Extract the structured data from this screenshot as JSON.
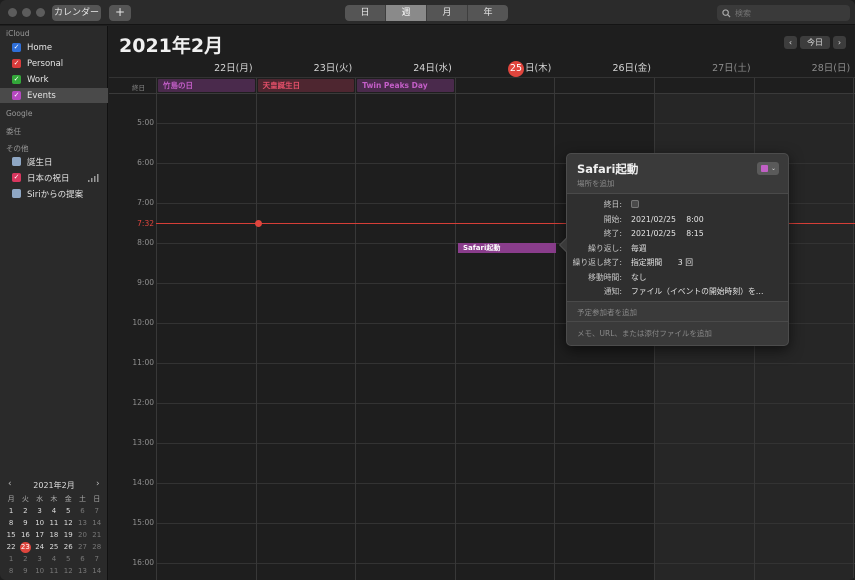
{
  "toolbar": {
    "calendars_label": "カレンダー",
    "add_label": "+",
    "views": [
      {
        "label": "日",
        "active": false
      },
      {
        "label": "週",
        "active": true
      },
      {
        "label": "月",
        "active": false
      },
      {
        "label": "年",
        "active": false
      }
    ],
    "search_placeholder": "検索"
  },
  "sidebar": {
    "icloud_header": "iCloud",
    "icloud": [
      {
        "label": "Home",
        "color": "#2f6fd8",
        "checked": true,
        "selected": false
      },
      {
        "label": "Personal",
        "color": "#d83b3b",
        "checked": true,
        "selected": false
      },
      {
        "label": "Work",
        "color": "#33a83a",
        "checked": true,
        "selected": false
      },
      {
        "label": "Events",
        "color": "#b548c0",
        "checked": true,
        "selected": true
      }
    ],
    "google_header": "Google",
    "delegated_header": "委任",
    "other_header": "その他",
    "other": [
      {
        "label": "誕生日",
        "color": "#8fa7c4",
        "checked": false
      },
      {
        "label": "日本の祝日",
        "color": "#d8365e",
        "checked": true
      },
      {
        "label": "Siriからの提案",
        "color": "#8fa7c4",
        "checked": false
      }
    ]
  },
  "mini": {
    "title": "2021年2月",
    "prev": "‹",
    "next": "›",
    "weekdays": [
      "月",
      "火",
      "水",
      "木",
      "金",
      "土",
      "日"
    ],
    "weeks": [
      [
        {
          "d": "1",
          "dim": false
        },
        {
          "d": "2",
          "dim": false
        },
        {
          "d": "3",
          "dim": false
        },
        {
          "d": "4",
          "dim": false
        },
        {
          "d": "5",
          "dim": false
        },
        {
          "d": "6",
          "dim": true
        },
        {
          "d": "7",
          "dim": true
        }
      ],
      [
        {
          "d": "8",
          "dim": false
        },
        {
          "d": "9",
          "dim": false
        },
        {
          "d": "10",
          "dim": false
        },
        {
          "d": "11",
          "dim": false
        },
        {
          "d": "12",
          "dim": false
        },
        {
          "d": "13",
          "dim": true
        },
        {
          "d": "14",
          "dim": true
        }
      ],
      [
        {
          "d": "15",
          "dim": false
        },
        {
          "d": "16",
          "dim": false
        },
        {
          "d": "17",
          "dim": false
        },
        {
          "d": "18",
          "dim": false
        },
        {
          "d": "19",
          "dim": false
        },
        {
          "d": "20",
          "dim": true
        },
        {
          "d": "21",
          "dim": true
        }
      ],
      [
        {
          "d": "22",
          "dim": false
        },
        {
          "d": "23",
          "dim": false,
          "today": true
        },
        {
          "d": "24",
          "dim": false
        },
        {
          "d": "25",
          "dim": false
        },
        {
          "d": "26",
          "dim": false
        },
        {
          "d": "27",
          "dim": true
        },
        {
          "d": "28",
          "dim": true
        }
      ],
      [
        {
          "d": "1",
          "dim": true
        },
        {
          "d": "2",
          "dim": true
        },
        {
          "d": "3",
          "dim": true
        },
        {
          "d": "4",
          "dim": true
        },
        {
          "d": "5",
          "dim": true
        },
        {
          "d": "6",
          "dim": true
        },
        {
          "d": "7",
          "dim": true
        }
      ],
      [
        {
          "d": "8",
          "dim": true
        },
        {
          "d": "9",
          "dim": true
        },
        {
          "d": "10",
          "dim": true
        },
        {
          "d": "11",
          "dim": true
        },
        {
          "d": "12",
          "dim": true
        },
        {
          "d": "13",
          "dim": true
        },
        {
          "d": "14",
          "dim": true
        }
      ]
    ]
  },
  "main": {
    "title": "2021年2月",
    "nav_prev": "‹",
    "nav_today": "今日",
    "nav_next": "›",
    "days": [
      {
        "date": "22日",
        "dow": "(月)",
        "weekend": false
      },
      {
        "date": "23日",
        "dow": "(火)",
        "weekend": false
      },
      {
        "date": "24日",
        "dow": "(水)",
        "weekend": false
      },
      {
        "date": "25",
        "dow": "日(木)",
        "weekend": false,
        "today": true
      },
      {
        "date": "26日",
        "dow": "(金)",
        "weekend": false
      },
      {
        "date": "27日",
        "dow": "(土)",
        "weekend": true
      },
      {
        "date": "28日",
        "dow": "(日)",
        "weekend": true
      }
    ],
    "allday_label": "終日",
    "allday_events": [
      {
        "title": "竹島の日",
        "day": 0,
        "color": "#c45ec8",
        "bg": "#4a2a4c"
      },
      {
        "title": "天皇誕生日",
        "day": 1,
        "color": "#e5506a",
        "bg": "#4e2630"
      },
      {
        "title": "Twin Peaks Day",
        "day": 2,
        "color": "#c45ec8",
        "bg": "#4a2a4c"
      }
    ],
    "hours": [
      "5:00",
      "6:00",
      "7:00",
      "8:00",
      "9:00",
      "10:00",
      "11:00",
      "12:00",
      "13:00",
      "14:00",
      "15:00",
      "16:00"
    ],
    "now_label": "7:32",
    "event": {
      "title": "Safari起動"
    }
  },
  "popover": {
    "title": "Safari起動",
    "location_placeholder": "場所を追加",
    "rows": [
      {
        "label": "終日:",
        "value": ""
      },
      {
        "label": "開始:",
        "value": "2021/02/25　 8:00"
      },
      {
        "label": "終了:",
        "value": "2021/02/25　 8:15"
      },
      {
        "label": "繰り返し:",
        "value": "毎週"
      },
      {
        "label": "繰り返し終了:",
        "value": "指定期間　　3 回"
      },
      {
        "label": "移動時間:",
        "value": "なし"
      },
      {
        "label": "通知:",
        "value": "ファイル（イベントの開始時刻）を…"
      }
    ],
    "invitees_placeholder": "予定参加者を追加",
    "notes_placeholder": "メモ、URL、または添付ファイルを追加"
  }
}
